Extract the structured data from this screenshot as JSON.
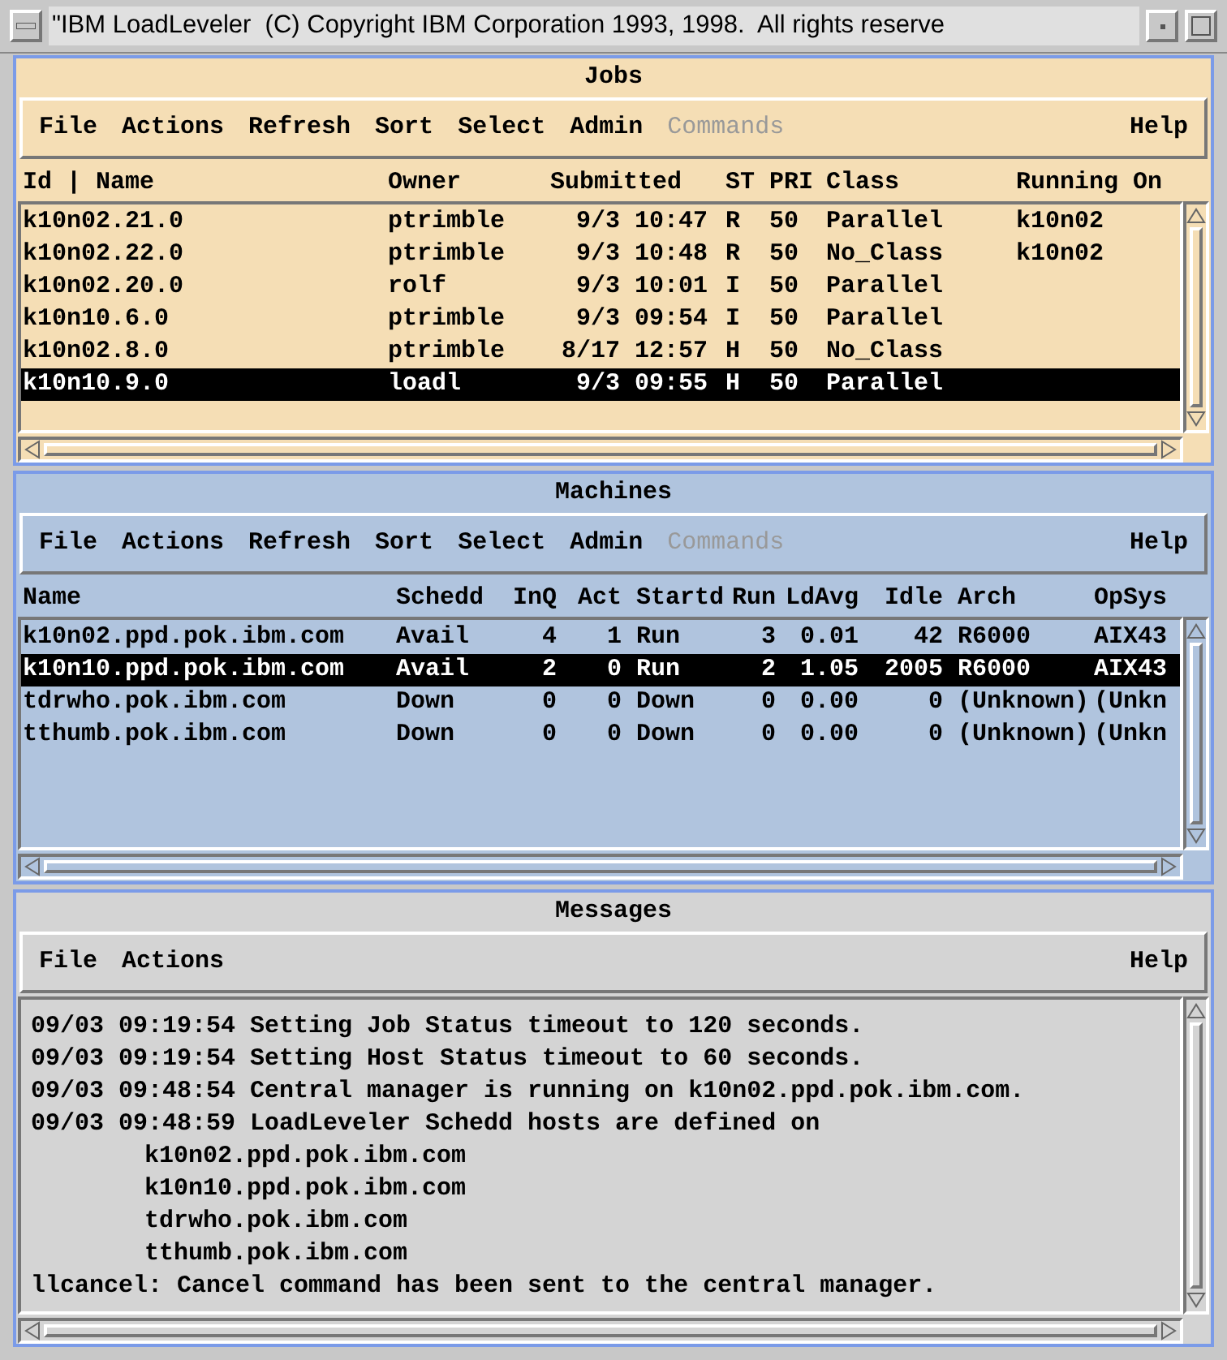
{
  "window": {
    "title": "\"IBM LoadLeveler  (C) Copyright IBM Corporation 1993, 1998.  All rights reserve"
  },
  "jobs": {
    "title": "Jobs",
    "menu": [
      {
        "label": "File",
        "disabled": false
      },
      {
        "label": "Actions",
        "disabled": false
      },
      {
        "label": "Refresh",
        "disabled": false
      },
      {
        "label": "Sort",
        "disabled": false
      },
      {
        "label": "Select",
        "disabled": false
      },
      {
        "label": "Admin",
        "disabled": false
      },
      {
        "label": "Commands",
        "disabled": true
      }
    ],
    "help": "Help",
    "columns": [
      {
        "label": "Id | Name"
      },
      {
        "label": "Owner"
      },
      {
        "label": "Submitted"
      },
      {
        "label": "ST"
      },
      {
        "label": "PRI"
      },
      {
        "label": "Class"
      },
      {
        "label": "Running On"
      }
    ],
    "rows": [
      {
        "cells": [
          "k10n02.21.0",
          "ptrimble",
          "9/3 10:47",
          "R",
          "50",
          "Parallel",
          "k10n02"
        ],
        "selected": false
      },
      {
        "cells": [
          "k10n02.22.0",
          "ptrimble",
          "9/3 10:48",
          "R",
          "50",
          "No_Class",
          "k10n02"
        ],
        "selected": false
      },
      {
        "cells": [
          "k10n02.20.0",
          "rolf",
          "9/3 10:01",
          "I",
          "50",
          "Parallel",
          ""
        ],
        "selected": false
      },
      {
        "cells": [
          "k10n10.6.0",
          "ptrimble",
          "9/3 09:54",
          "I",
          "50",
          "Parallel",
          ""
        ],
        "selected": false
      },
      {
        "cells": [
          "k10n02.8.0",
          "ptrimble",
          "8/17 12:57",
          "H",
          "50",
          "No_Class",
          ""
        ],
        "selected": false
      },
      {
        "cells": [
          "k10n10.9.0",
          "loadl",
          "9/3 09:55",
          "H",
          "50",
          "Parallel",
          ""
        ],
        "selected": true
      }
    ]
  },
  "machines": {
    "title": "Machines",
    "menu": [
      {
        "label": "File",
        "disabled": false
      },
      {
        "label": "Actions",
        "disabled": false
      },
      {
        "label": "Refresh",
        "disabled": false
      },
      {
        "label": "Sort",
        "disabled": false
      },
      {
        "label": "Select",
        "disabled": false
      },
      {
        "label": "Admin",
        "disabled": false
      },
      {
        "label": "Commands",
        "disabled": true
      }
    ],
    "help": "Help",
    "columns": [
      {
        "label": "Name"
      },
      {
        "label": "Schedd"
      },
      {
        "label": "InQ"
      },
      {
        "label": "Act"
      },
      {
        "label": "Startd"
      },
      {
        "label": "Run"
      },
      {
        "label": "LdAvg"
      },
      {
        "label": "Idle"
      },
      {
        "label": "Arch"
      },
      {
        "label": "OpSys"
      }
    ],
    "rows": [
      {
        "cells": [
          "k10n02.ppd.pok.ibm.com",
          "Avail",
          "4",
          "1",
          "Run",
          "3",
          "0.01",
          "42",
          "R6000",
          "AIX43"
        ],
        "selected": false
      },
      {
        "cells": [
          "k10n10.ppd.pok.ibm.com",
          "Avail",
          "2",
          "0",
          "Run",
          "2",
          "1.05",
          "2005",
          "R6000",
          "AIX43"
        ],
        "selected": true
      },
      {
        "cells": [
          "tdrwho.pok.ibm.com",
          "Down",
          "0",
          "0",
          "Down",
          "0",
          "0.00",
          "0",
          "(Unknown)",
          "(Unkn"
        ],
        "selected": false
      },
      {
        "cells": [
          "tthumb.pok.ibm.com",
          "Down",
          "0",
          "0",
          "Down",
          "0",
          "0.00",
          "0",
          "(Unknown)",
          "(Unkn"
        ],
        "selected": false
      }
    ]
  },
  "messages": {
    "title": "Messages",
    "menu": [
      {
        "label": "File",
        "disabled": false
      },
      {
        "label": "Actions",
        "disabled": false
      }
    ],
    "help": "Help",
    "lines": [
      {
        "text": "09/03 09:19:54 Setting Job Status timeout to 120 seconds."
      },
      {
        "text": "09/03 09:19:54 Setting Host Status timeout to 60 seconds."
      },
      {
        "text": "09/03 09:48:54 Central manager is running on k10n02.ppd.pok.ibm.com."
      },
      {
        "text": "09/03 09:48:59 LoadLeveler Schedd hosts are defined on",
        "children": [
          {
            "text": "k10n02.ppd.pok.ibm.com"
          },
          {
            "text": "k10n10.ppd.pok.ibm.com"
          },
          {
            "text": "tdrwho.pok.ibm.com"
          },
          {
            "text": "tthumb.pok.ibm.com"
          }
        ]
      },
      {
        "text": "llcancel: Cancel command has been sent to the central manager."
      }
    ]
  }
}
